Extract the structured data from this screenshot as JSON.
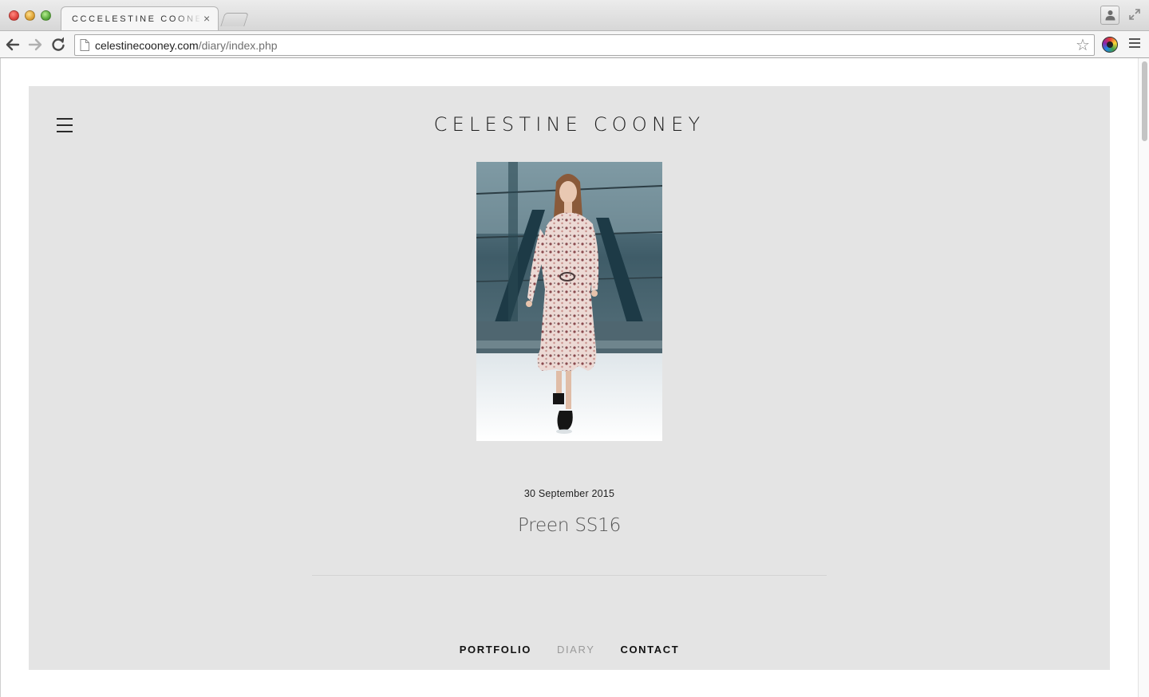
{
  "browser": {
    "tab_title": "CCCELESTINE COONEY",
    "tab_close": "×",
    "url_domain": "celestinecooney.com",
    "url_path": "/diary/index.php"
  },
  "site": {
    "title": "CELESTINE COONEY"
  },
  "post": {
    "image_alt": "Preen SS16 runway look",
    "date": "30 September 2015",
    "title": "Preen SS16"
  },
  "footer_nav": [
    {
      "label": "PORTFOLIO",
      "active": false
    },
    {
      "label": "DIARY",
      "active": true
    },
    {
      "label": "CONTACT",
      "active": false
    }
  ],
  "colors": {
    "page_background": "#e4e4e4",
    "text": "#111111",
    "active_nav": "#9a9a9a"
  }
}
